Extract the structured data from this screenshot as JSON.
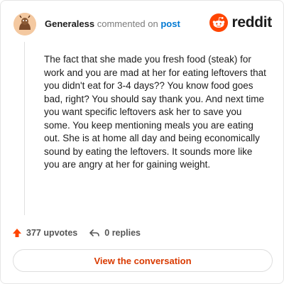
{
  "comment": {
    "username": "Generaless",
    "action_text": "commented on",
    "target_link": "post",
    "body": "The fact that she made you fresh food (steak) for work and you are mad at her for eating leftovers that you didn't eat for 3-4 days?? You know food goes bad, right? You should say thank you. And next time you want specific leftovers ask her to save you some. You keep mentioning meals you are eating out. She is at home all day and being economically sound by eating the leftovers. It sounds more like you are angry at her for gaining weight."
  },
  "brand": {
    "wordmark": "reddit",
    "accent_color": "#ff4500",
    "logo_icon": "reddit-snoo-icon"
  },
  "actions": {
    "upvotes_label": "377 upvotes",
    "replies_label": "0 replies",
    "upvote_icon": "upvote-arrow-icon",
    "reply_icon": "reply-arrow-icon"
  },
  "cta": {
    "label": "View the conversation",
    "color": "#d93a00"
  }
}
